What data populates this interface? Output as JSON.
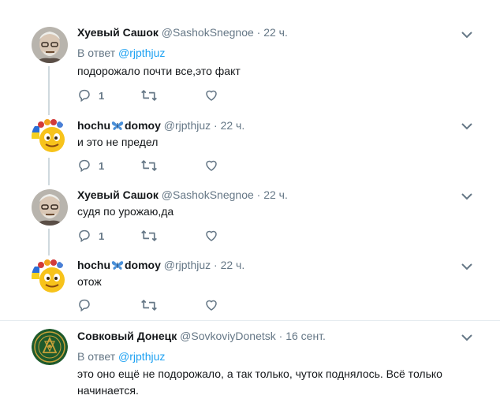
{
  "tweets": [
    {
      "name": "Хуевый Сашок",
      "handle": "@SashokSnegnoe",
      "dot": "·",
      "time": "22 ч.",
      "reply_prefix": "В ответ",
      "reply_to": "@rjpthjuz",
      "text": "подорожало почти все,это факт",
      "reply_count": "1",
      "avatar": "elderly-man-avatar"
    },
    {
      "name_part1": "hochu",
      "name_part2": "domoy",
      "handle": "@rjpthjuz",
      "dot": "·",
      "time": "22 ч.",
      "text": "и это не предел",
      "reply_count": "1",
      "avatar": "emoji-avatar"
    },
    {
      "name": "Хуевый Сашок",
      "handle": "@SashokSnegnoe",
      "dot": "·",
      "time": "22 ч.",
      "text": "судя по урожаю,да",
      "reply_count": "1",
      "avatar": "elderly-man-avatar"
    },
    {
      "name_part1": "hochu",
      "name_part2": "domoy",
      "handle": "@rjpthjuz",
      "dot": "·",
      "time": "22 ч.",
      "text": "отож",
      "reply_count": "",
      "avatar": "emoji-avatar"
    },
    {
      "name": "Совковый Донецк",
      "handle": "@SovkoviyDonetsk",
      "dot": "·",
      "time": "16 сент.",
      "reply_prefix": "В ответ",
      "reply_to": "@rjpthjuz",
      "text_line1": "это оно ещё не подорожало, а так только, чуток поднялось. Всё только",
      "text_line2": "начинается.",
      "avatar": "emblem-avatar"
    }
  ],
  "colors": {
    "accent": "#1da1f2",
    "secondary": "#657786",
    "border": "#e6ecf0",
    "thread_line": "#cfd9de",
    "emblem_green": "#1e5a2c",
    "emblem_gold": "#c9a23a",
    "butterfly": "#4a90d9"
  },
  "icons": [
    "reply-icon",
    "retweet-icon",
    "like-icon",
    "chevron-down-icon",
    "butterfly-icon"
  ]
}
